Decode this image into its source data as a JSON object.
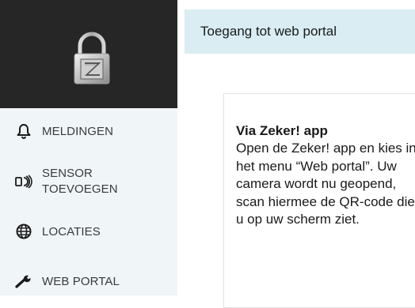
{
  "sidebar": {
    "logo": {
      "letter": "Z",
      "icon": "padlock-logo"
    },
    "items": [
      {
        "label": "MELDINGEN",
        "icon": "bell-icon"
      },
      {
        "label_line1": "SENSOR",
        "label_line2": "TOEVOEGEN",
        "icon": "sensor-icon"
      },
      {
        "label": "LOCATIES",
        "icon": "globe-icon"
      },
      {
        "label": "WEB PORTAL",
        "icon": "wrench-icon"
      }
    ]
  },
  "main": {
    "header": {
      "title": "Toegang tot web portal"
    },
    "card": {
      "heading": "Via Zeker! app",
      "text": "Open de Zeker! app en kies in het menu “Web portal”. Uw camera wordt nu geopend, scan hiermee de QR-code die u op uw scherm ziet."
    }
  },
  "colors": {
    "sidebar_bg": "#f0f5f8",
    "sidebar_header_bg": "#262626",
    "header_bg": "#d9edf2",
    "text": "#1a1a1a"
  }
}
